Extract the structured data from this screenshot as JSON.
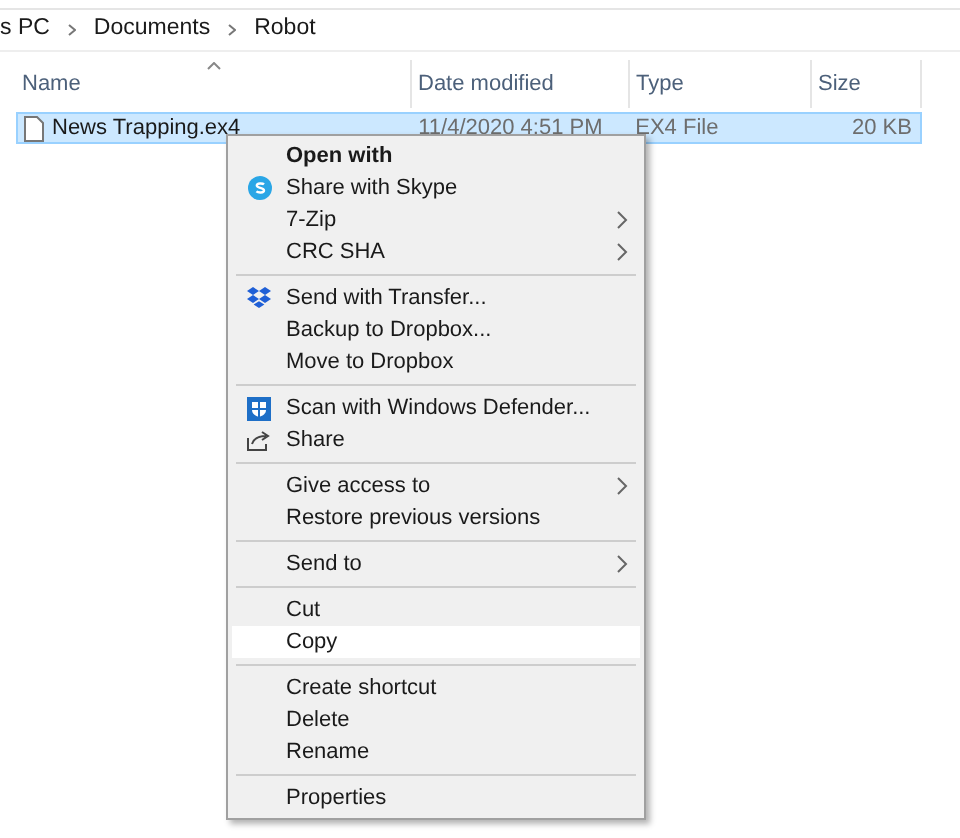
{
  "breadcrumb": [
    "s PC",
    "Documents",
    "Robot"
  ],
  "table": {
    "columns": [
      {
        "label": "Name",
        "sorted": true
      },
      {
        "label": "Date modified",
        "sorted": false
      },
      {
        "label": "Type",
        "sorted": false
      },
      {
        "label": "Size",
        "sorted": false
      }
    ],
    "rows": [
      {
        "name": "News Trapping.ex4",
        "date": "11/4/2020 4:51 PM",
        "type": "EX4 File",
        "size": "20 KB",
        "selected": true
      }
    ]
  },
  "context_menu": [
    {
      "kind": "item",
      "label": "Open with",
      "bold": true,
      "submenu": false,
      "selected": false
    },
    {
      "kind": "skype",
      "label": "Share with Skype",
      "bold": false,
      "submenu": false,
      "selected": false
    },
    {
      "kind": "item",
      "label": "7-Zip",
      "bold": false,
      "submenu": true,
      "selected": false
    },
    {
      "kind": "item",
      "label": "CRC SHA",
      "bold": false,
      "submenu": true,
      "selected": false
    },
    {
      "kind": "separator"
    },
    {
      "kind": "dropbox",
      "label": "Send with Transfer...",
      "bold": false,
      "submenu": false,
      "selected": false
    },
    {
      "kind": "item",
      "label": "Backup to Dropbox...",
      "bold": false,
      "submenu": false,
      "selected": false
    },
    {
      "kind": "item",
      "label": "Move to Dropbox",
      "bold": false,
      "submenu": false,
      "selected": false
    },
    {
      "kind": "separator"
    },
    {
      "kind": "shield",
      "label": "Scan with Windows Defender...",
      "bold": false,
      "submenu": false,
      "selected": false
    },
    {
      "kind": "share",
      "label": "Share",
      "bold": false,
      "submenu": false,
      "selected": false
    },
    {
      "kind": "separator"
    },
    {
      "kind": "item",
      "label": "Give access to",
      "bold": false,
      "submenu": true,
      "selected": false
    },
    {
      "kind": "item",
      "label": "Restore previous versions",
      "bold": false,
      "submenu": false,
      "selected": false
    },
    {
      "kind": "separator"
    },
    {
      "kind": "item",
      "label": "Send to",
      "bold": false,
      "submenu": true,
      "selected": false
    },
    {
      "kind": "separator"
    },
    {
      "kind": "item",
      "label": "Cut",
      "bold": false,
      "submenu": false,
      "selected": false
    },
    {
      "kind": "item",
      "label": "Copy",
      "bold": false,
      "submenu": false,
      "selected": true
    },
    {
      "kind": "separator"
    },
    {
      "kind": "item",
      "label": "Create shortcut",
      "bold": false,
      "submenu": false,
      "selected": false
    },
    {
      "kind": "item",
      "label": "Delete",
      "bold": false,
      "submenu": false,
      "selected": false
    },
    {
      "kind": "item",
      "label": "Rename",
      "bold": false,
      "submenu": false,
      "selected": false
    },
    {
      "kind": "separator"
    },
    {
      "kind": "item",
      "label": "Properties",
      "bold": false,
      "submenu": false,
      "selected": false
    }
  ]
}
